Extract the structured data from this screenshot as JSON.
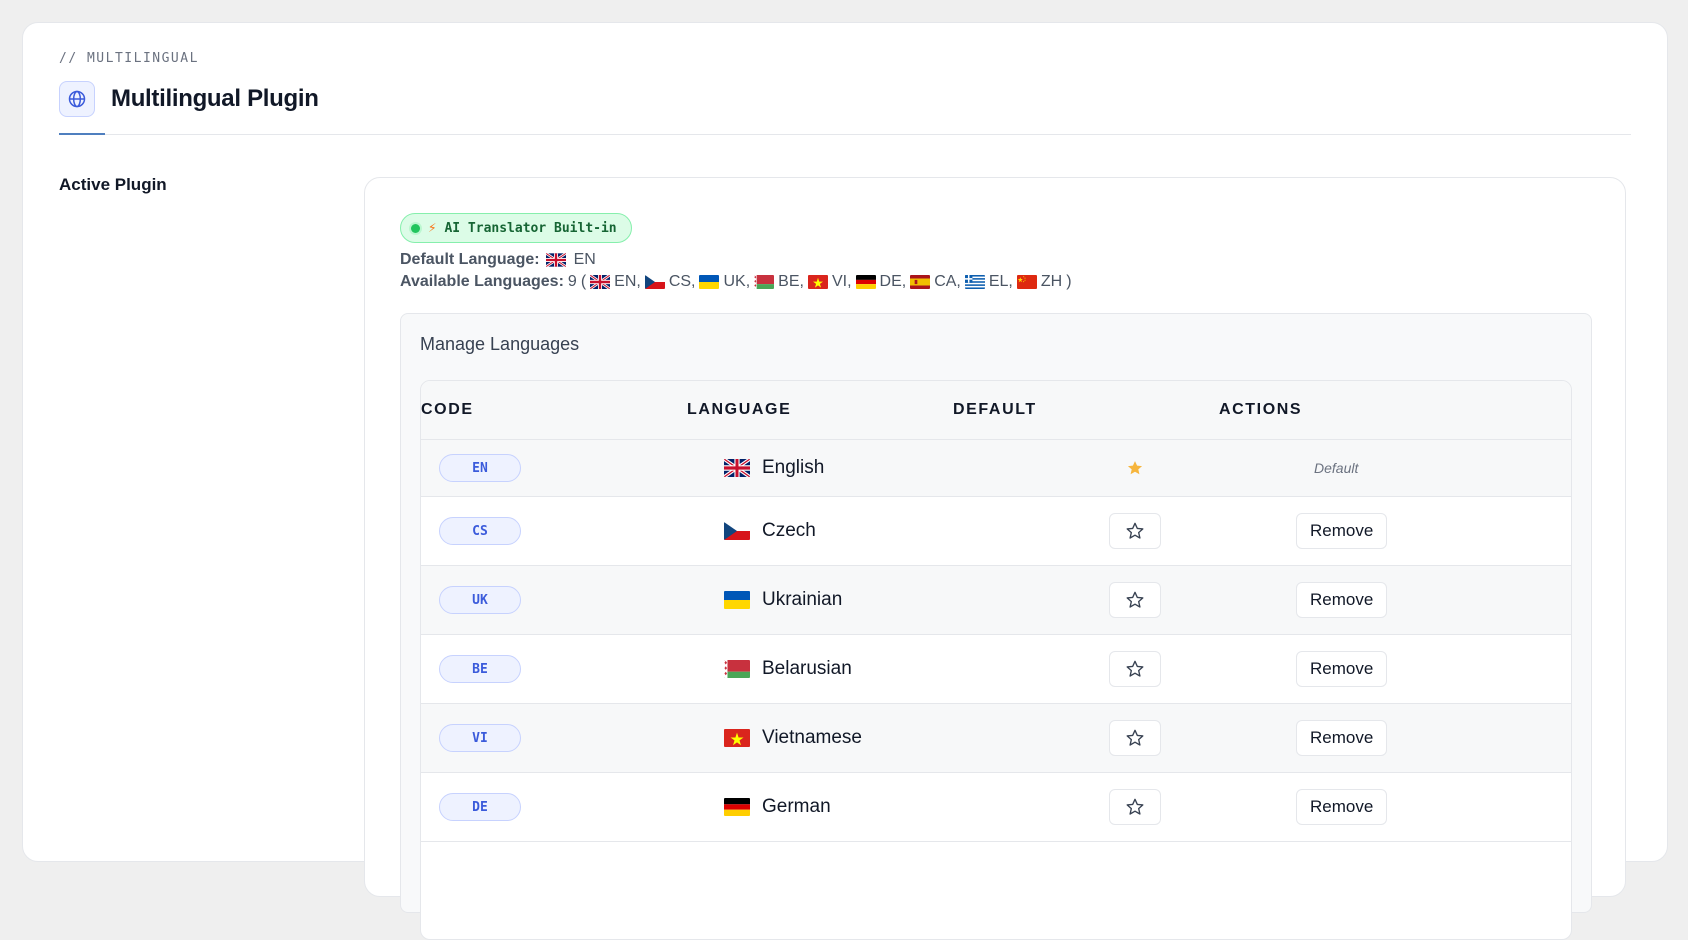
{
  "header": {
    "eyebrow": "// MULTILINGUAL",
    "title": "Multilingual Plugin",
    "icon": "globe-icon"
  },
  "section": {
    "label": "Active Plugin"
  },
  "plugin": {
    "badge_label": "AI Translator Built-in",
    "badge_icon": "bolt-icon",
    "default_language_label": "Default Language:",
    "default_language_code": "EN",
    "available_languages_label": "Available Languages:",
    "available_count": "9",
    "available_list": [
      "EN",
      "CS",
      "UK",
      "BE",
      "VI",
      "DE",
      "CA",
      "EL",
      "ZH"
    ]
  },
  "manage": {
    "title": "Manage Languages",
    "columns": [
      "CODE",
      "LANGUAGE",
      "DEFAULT",
      "ACTIONS"
    ],
    "rows": [
      {
        "code": "EN",
        "name": "English",
        "flag": "gb",
        "is_default": true,
        "action": "Default"
      },
      {
        "code": "CS",
        "name": "Czech",
        "flag": "cz",
        "is_default": false,
        "action": "Remove"
      },
      {
        "code": "UK",
        "name": "Ukrainian",
        "flag": "ua",
        "is_default": false,
        "action": "Remove"
      },
      {
        "code": "BE",
        "name": "Belarusian",
        "flag": "by",
        "is_default": false,
        "action": "Remove"
      },
      {
        "code": "VI",
        "name": "Vietnamese",
        "flag": "vn",
        "is_default": false,
        "action": "Remove"
      },
      {
        "code": "DE",
        "name": "German",
        "flag": "de",
        "is_default": false,
        "action": "Remove"
      }
    ]
  },
  "colors": {
    "accent": "#4f7fbf",
    "badge_bg": "#dcfce7",
    "badge_text": "#166534",
    "star_active": "#f6b53d",
    "code_pill_text": "#3b5bdb"
  }
}
